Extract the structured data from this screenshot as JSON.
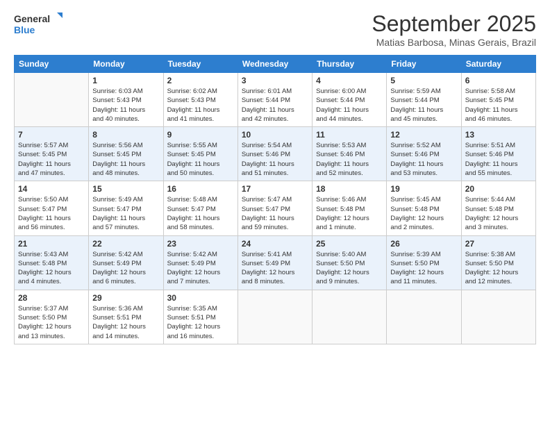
{
  "header": {
    "logo_line1": "General",
    "logo_line2": "Blue",
    "month": "September 2025",
    "location": "Matias Barbosa, Minas Gerais, Brazil"
  },
  "days_of_week": [
    "Sunday",
    "Monday",
    "Tuesday",
    "Wednesday",
    "Thursday",
    "Friday",
    "Saturday"
  ],
  "weeks": [
    [
      {
        "day": "",
        "info": ""
      },
      {
        "day": "1",
        "info": "Sunrise: 6:03 AM\nSunset: 5:43 PM\nDaylight: 11 hours\nand 40 minutes."
      },
      {
        "day": "2",
        "info": "Sunrise: 6:02 AM\nSunset: 5:43 PM\nDaylight: 11 hours\nand 41 minutes."
      },
      {
        "day": "3",
        "info": "Sunrise: 6:01 AM\nSunset: 5:44 PM\nDaylight: 11 hours\nand 42 minutes."
      },
      {
        "day": "4",
        "info": "Sunrise: 6:00 AM\nSunset: 5:44 PM\nDaylight: 11 hours\nand 44 minutes."
      },
      {
        "day": "5",
        "info": "Sunrise: 5:59 AM\nSunset: 5:44 PM\nDaylight: 11 hours\nand 45 minutes."
      },
      {
        "day": "6",
        "info": "Sunrise: 5:58 AM\nSunset: 5:45 PM\nDaylight: 11 hours\nand 46 minutes."
      }
    ],
    [
      {
        "day": "7",
        "info": "Sunrise: 5:57 AM\nSunset: 5:45 PM\nDaylight: 11 hours\nand 47 minutes."
      },
      {
        "day": "8",
        "info": "Sunrise: 5:56 AM\nSunset: 5:45 PM\nDaylight: 11 hours\nand 48 minutes."
      },
      {
        "day": "9",
        "info": "Sunrise: 5:55 AM\nSunset: 5:45 PM\nDaylight: 11 hours\nand 50 minutes."
      },
      {
        "day": "10",
        "info": "Sunrise: 5:54 AM\nSunset: 5:46 PM\nDaylight: 11 hours\nand 51 minutes."
      },
      {
        "day": "11",
        "info": "Sunrise: 5:53 AM\nSunset: 5:46 PM\nDaylight: 11 hours\nand 52 minutes."
      },
      {
        "day": "12",
        "info": "Sunrise: 5:52 AM\nSunset: 5:46 PM\nDaylight: 11 hours\nand 53 minutes."
      },
      {
        "day": "13",
        "info": "Sunrise: 5:51 AM\nSunset: 5:46 PM\nDaylight: 11 hours\nand 55 minutes."
      }
    ],
    [
      {
        "day": "14",
        "info": "Sunrise: 5:50 AM\nSunset: 5:47 PM\nDaylight: 11 hours\nand 56 minutes."
      },
      {
        "day": "15",
        "info": "Sunrise: 5:49 AM\nSunset: 5:47 PM\nDaylight: 11 hours\nand 57 minutes."
      },
      {
        "day": "16",
        "info": "Sunrise: 5:48 AM\nSunset: 5:47 PM\nDaylight: 11 hours\nand 58 minutes."
      },
      {
        "day": "17",
        "info": "Sunrise: 5:47 AM\nSunset: 5:47 PM\nDaylight: 11 hours\nand 59 minutes."
      },
      {
        "day": "18",
        "info": "Sunrise: 5:46 AM\nSunset: 5:48 PM\nDaylight: 12 hours\nand 1 minute."
      },
      {
        "day": "19",
        "info": "Sunrise: 5:45 AM\nSunset: 5:48 PM\nDaylight: 12 hours\nand 2 minutes."
      },
      {
        "day": "20",
        "info": "Sunrise: 5:44 AM\nSunset: 5:48 PM\nDaylight: 12 hours\nand 3 minutes."
      }
    ],
    [
      {
        "day": "21",
        "info": "Sunrise: 5:43 AM\nSunset: 5:48 PM\nDaylight: 12 hours\nand 4 minutes."
      },
      {
        "day": "22",
        "info": "Sunrise: 5:42 AM\nSunset: 5:49 PM\nDaylight: 12 hours\nand 6 minutes."
      },
      {
        "day": "23",
        "info": "Sunrise: 5:42 AM\nSunset: 5:49 PM\nDaylight: 12 hours\nand 7 minutes."
      },
      {
        "day": "24",
        "info": "Sunrise: 5:41 AM\nSunset: 5:49 PM\nDaylight: 12 hours\nand 8 minutes."
      },
      {
        "day": "25",
        "info": "Sunrise: 5:40 AM\nSunset: 5:50 PM\nDaylight: 12 hours\nand 9 minutes."
      },
      {
        "day": "26",
        "info": "Sunrise: 5:39 AM\nSunset: 5:50 PM\nDaylight: 12 hours\nand 11 minutes."
      },
      {
        "day": "27",
        "info": "Sunrise: 5:38 AM\nSunset: 5:50 PM\nDaylight: 12 hours\nand 12 minutes."
      }
    ],
    [
      {
        "day": "28",
        "info": "Sunrise: 5:37 AM\nSunset: 5:50 PM\nDaylight: 12 hours\nand 13 minutes."
      },
      {
        "day": "29",
        "info": "Sunrise: 5:36 AM\nSunset: 5:51 PM\nDaylight: 12 hours\nand 14 minutes."
      },
      {
        "day": "30",
        "info": "Sunrise: 5:35 AM\nSunset: 5:51 PM\nDaylight: 12 hours\nand 16 minutes."
      },
      {
        "day": "",
        "info": ""
      },
      {
        "day": "",
        "info": ""
      },
      {
        "day": "",
        "info": ""
      },
      {
        "day": "",
        "info": ""
      }
    ]
  ]
}
